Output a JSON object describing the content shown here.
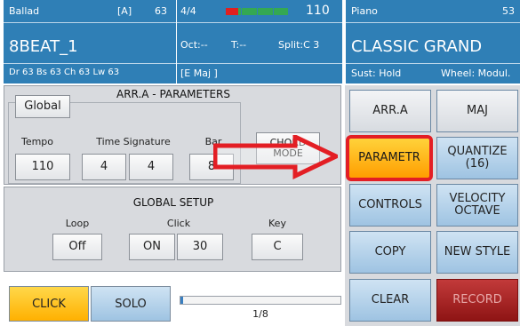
{
  "style_panel": {
    "name": "Ballad",
    "variation": "[A]",
    "tempo_num": "63",
    "title": "8BEAT_1",
    "volumes": "Dr 63  Bs 63  Ch 63  Lw 63"
  },
  "center_panel": {
    "time_sig": "4/4",
    "tempo": "110",
    "oct": "Oct:--",
    "trans": "T:--",
    "split": "Split:C 3",
    "chord": "[E Maj          ]"
  },
  "voice_panel": {
    "name": "Piano",
    "number": "53",
    "title": "CLASSIC GRAND",
    "sustain": "Sust: Hold",
    "wheel": "Wheel: Modul."
  },
  "params": {
    "title": "ARR.A - PARAMETERS",
    "global_tab": "Global",
    "tempo_label": "Tempo",
    "tempo_value": "110",
    "timesig_label": "Time Signature",
    "timesig_num": "4",
    "timesig_den": "4",
    "bar_label": "Bar",
    "bar_value": "8",
    "chord_mode": "CHORD MODE"
  },
  "global_setup": {
    "title": "GLOBAL SETUP",
    "loop_label": "Loop",
    "loop_value": "Off",
    "click_label": "Click",
    "click_on": "ON",
    "click_value": "30",
    "key_label": "Key",
    "key_value": "C"
  },
  "bottom": {
    "click": "CLICK",
    "solo": "SOLO",
    "position": "1/8"
  },
  "right_buttons": {
    "arr": "ARR.A",
    "maj": "MAJ",
    "parametr": "PARAMETR",
    "quantize_line1": "QUANTIZE",
    "quantize_line2": "(16)",
    "controls": "CONTROLS",
    "velocity_line1": "VELOCITY",
    "velocity_line2": "OCTAVE",
    "copy": "COPY",
    "new_style": "NEW STYLE",
    "clear": "CLEAR",
    "record": "RECORD"
  },
  "colors": {
    "header_blue": "#2f7fb6",
    "highlight_red": "#e31e24",
    "parametr_orange": "#ffb000"
  }
}
